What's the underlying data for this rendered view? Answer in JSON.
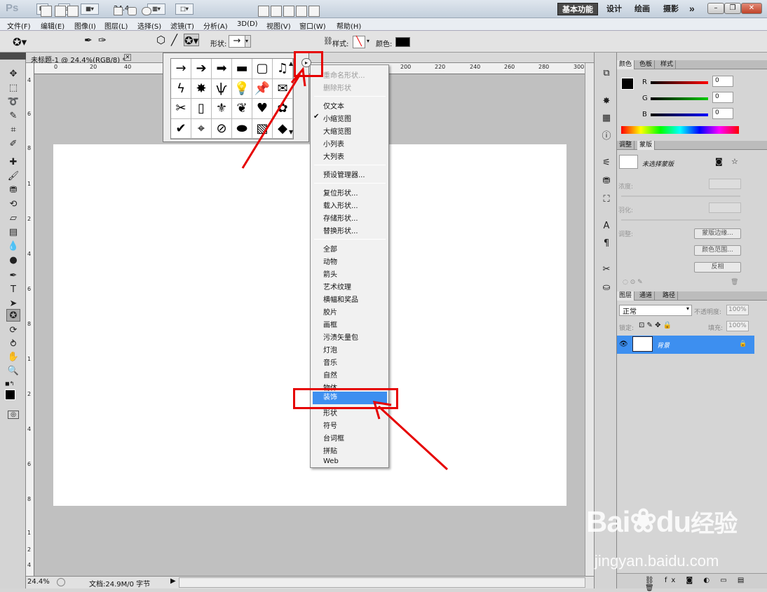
{
  "app": {
    "logo": "Ps",
    "br": "Br",
    "mb": "Mb",
    "zoom": "24.4"
  },
  "workspaces": [
    "基本功能",
    "设计",
    "绘画",
    "摄影",
    "»"
  ],
  "window_controls": {
    "minimize": "–",
    "restore": "❐",
    "close": "✕"
  },
  "menubar": [
    "文件(F)",
    "编辑(E)",
    "图像(I)",
    "图层(L)",
    "选择(S)",
    "滤镜(T)",
    "分析(A)",
    "3D(D)",
    "视图(V)",
    "窗口(W)",
    "帮助(H)"
  ],
  "options": {
    "shape_label": "形状:",
    "shape_value": "→",
    "style_label": "样式:",
    "color_label": "颜色:",
    "color_value": "#000000"
  },
  "document": {
    "tab_title": "未标题-1 @ 24.4%(RGB/8) *",
    "ruler_h": [
      "0",
      "20",
      "40",
      "200",
      "220",
      "240",
      "260",
      "280",
      "300"
    ],
    "ruler_v": [
      "4",
      "6",
      "8",
      "1",
      "2",
      "4",
      "6",
      "8",
      "1",
      "2",
      "4",
      "6",
      "8",
      "1",
      "2",
      "4"
    ],
    "status_zoom": "24.4%",
    "status_doc": "文档:24.9M/0 字节"
  },
  "shape_picker": {
    "cells": [
      "→",
      "➔",
      "➡",
      "▬",
      "▢",
      "♫",
      "ϟ",
      "✸",
      "ѱ",
      "💡",
      "📌",
      "✉",
      "✂",
      "▯",
      "⚜",
      "❦",
      "♥",
      "✿",
      "✔",
      "⌖",
      "⊘",
      "⬬",
      "▧",
      "◆"
    ]
  },
  "menu": {
    "group1": [
      "重命名形状...",
      "删除形状"
    ],
    "group2": [
      "仅文本",
      "小缩览图",
      "大缩览图",
      "小列表",
      "大列表"
    ],
    "group3": [
      "预设管理器..."
    ],
    "group4": [
      "复位形状...",
      "载入形状...",
      "存储形状...",
      "替换形状..."
    ],
    "group5": [
      "全部",
      "动物",
      "箭头",
      "艺术纹理",
      "横幅和奖品",
      "胶片",
      "画框",
      "污渍矢量包",
      "灯泡",
      "音乐",
      "自然",
      "物体",
      "装饰",
      "形状",
      "符号",
      "台词框",
      "拼贴",
      "Web"
    ],
    "checked": "小缩览图",
    "selected": "装饰",
    "check_mark": "✔"
  },
  "color_panel": {
    "tabs": [
      "颜色",
      "色板",
      "样式"
    ],
    "channels": [
      "R",
      "G",
      "B"
    ],
    "values": [
      "0",
      "0",
      "0"
    ]
  },
  "mask_panel": {
    "tabs": [
      "调整",
      "蒙版"
    ],
    "mask_name": "未选择蒙版",
    "density_label": "浓度:",
    "feather_label": "羽化:",
    "adjust_label": "调整:",
    "buttons": [
      "蒙版边缘...",
      "颜色范围...",
      "反相"
    ]
  },
  "layers_panel": {
    "tabs": [
      "图层",
      "通道",
      "路径"
    ],
    "blend_mode": "正常",
    "opacity_label": "不透明度:",
    "opacity_value": "100%",
    "lock_label": "锁定:",
    "fill_label": "填充:",
    "fill_value": "100%",
    "layer_name": "背景"
  },
  "watermark": {
    "brand": "Bai",
    "brand2": "du",
    "cn": "经验",
    "url": "jingyan.baidu.com"
  }
}
